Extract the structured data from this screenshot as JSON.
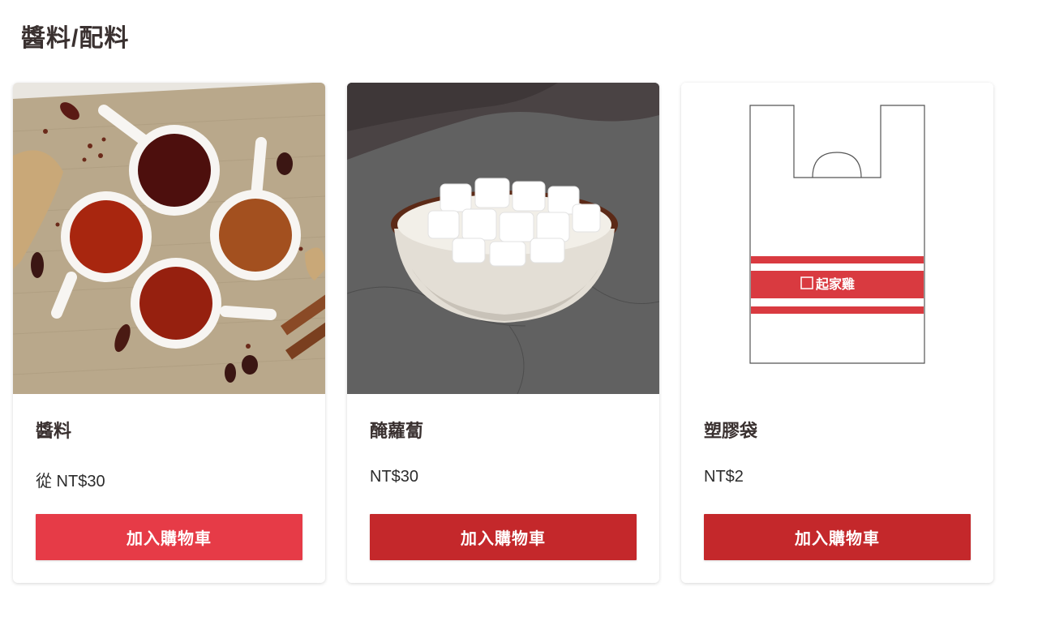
{
  "section": {
    "title": "醬料/配料"
  },
  "colors": {
    "brand_red": "#c4282b",
    "brand_red_light": "#e63b47",
    "title_text": "#3a3130"
  },
  "products": [
    {
      "name": "醬料",
      "price": "從 NT$30",
      "button_label": "加入購物車",
      "image_icon": "sauce-bowls-photo",
      "button_color": "#e63b47"
    },
    {
      "name": "醃蘿蔔",
      "price": "NT$30",
      "button_label": "加入購物車",
      "image_icon": "pickled-radish-photo",
      "button_color": "#c4282b"
    },
    {
      "name": "塑膠袋",
      "price": "NT$2",
      "button_label": "加入購物車",
      "image_icon": "plastic-bag-illustration",
      "button_color": "#c4282b",
      "bag_logo_text": "起家雞"
    }
  ]
}
